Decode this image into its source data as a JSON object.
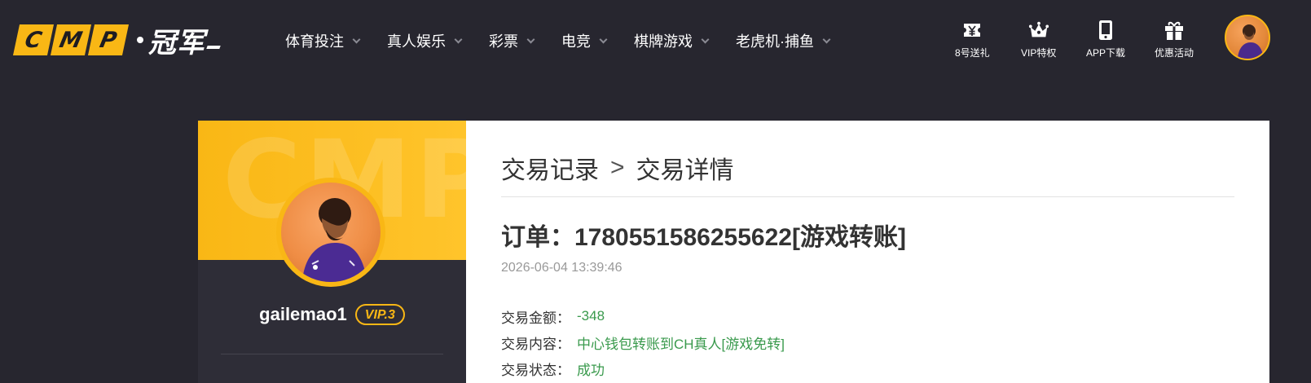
{
  "logo": {
    "letters": [
      "C",
      "M",
      "P"
    ],
    "brand_cn": "冠军"
  },
  "nav": [
    {
      "label": "体育投注"
    },
    {
      "label": "真人娱乐"
    },
    {
      "label": "彩票"
    },
    {
      "label": "电竞"
    },
    {
      "label": "棋牌游戏"
    },
    {
      "label": "老虎机·捕鱼"
    }
  ],
  "quick_links": [
    {
      "label": "8号送礼",
      "icon": "yen-ticket-icon"
    },
    {
      "label": "VIP特权",
      "icon": "crown-icon"
    },
    {
      "label": "APP下载",
      "icon": "phone-icon"
    },
    {
      "label": "优惠活动",
      "icon": "gift-icon"
    }
  ],
  "profile": {
    "banner_watermark": "CMP",
    "username": "gailemao1",
    "vip": "VIP.3"
  },
  "detail": {
    "breadcrumb": {
      "parent": "交易记录",
      "separator": ">",
      "current": "交易详情"
    },
    "order_title": "订单：1780551586255622[游戏转账]",
    "timestamp": "2026-06-04 13:39:46",
    "rows": [
      {
        "label": "交易金额：",
        "value": "-348"
      },
      {
        "label": "交易内容：",
        "value": "中心钱包转账到CH真人[游戏免转]"
      },
      {
        "label": "交易状态：",
        "value": "成功"
      }
    ]
  },
  "colors": {
    "background": "#27262f",
    "accent": "#f9b715",
    "success": "#3a9a4d",
    "panel": "#ffffff"
  }
}
